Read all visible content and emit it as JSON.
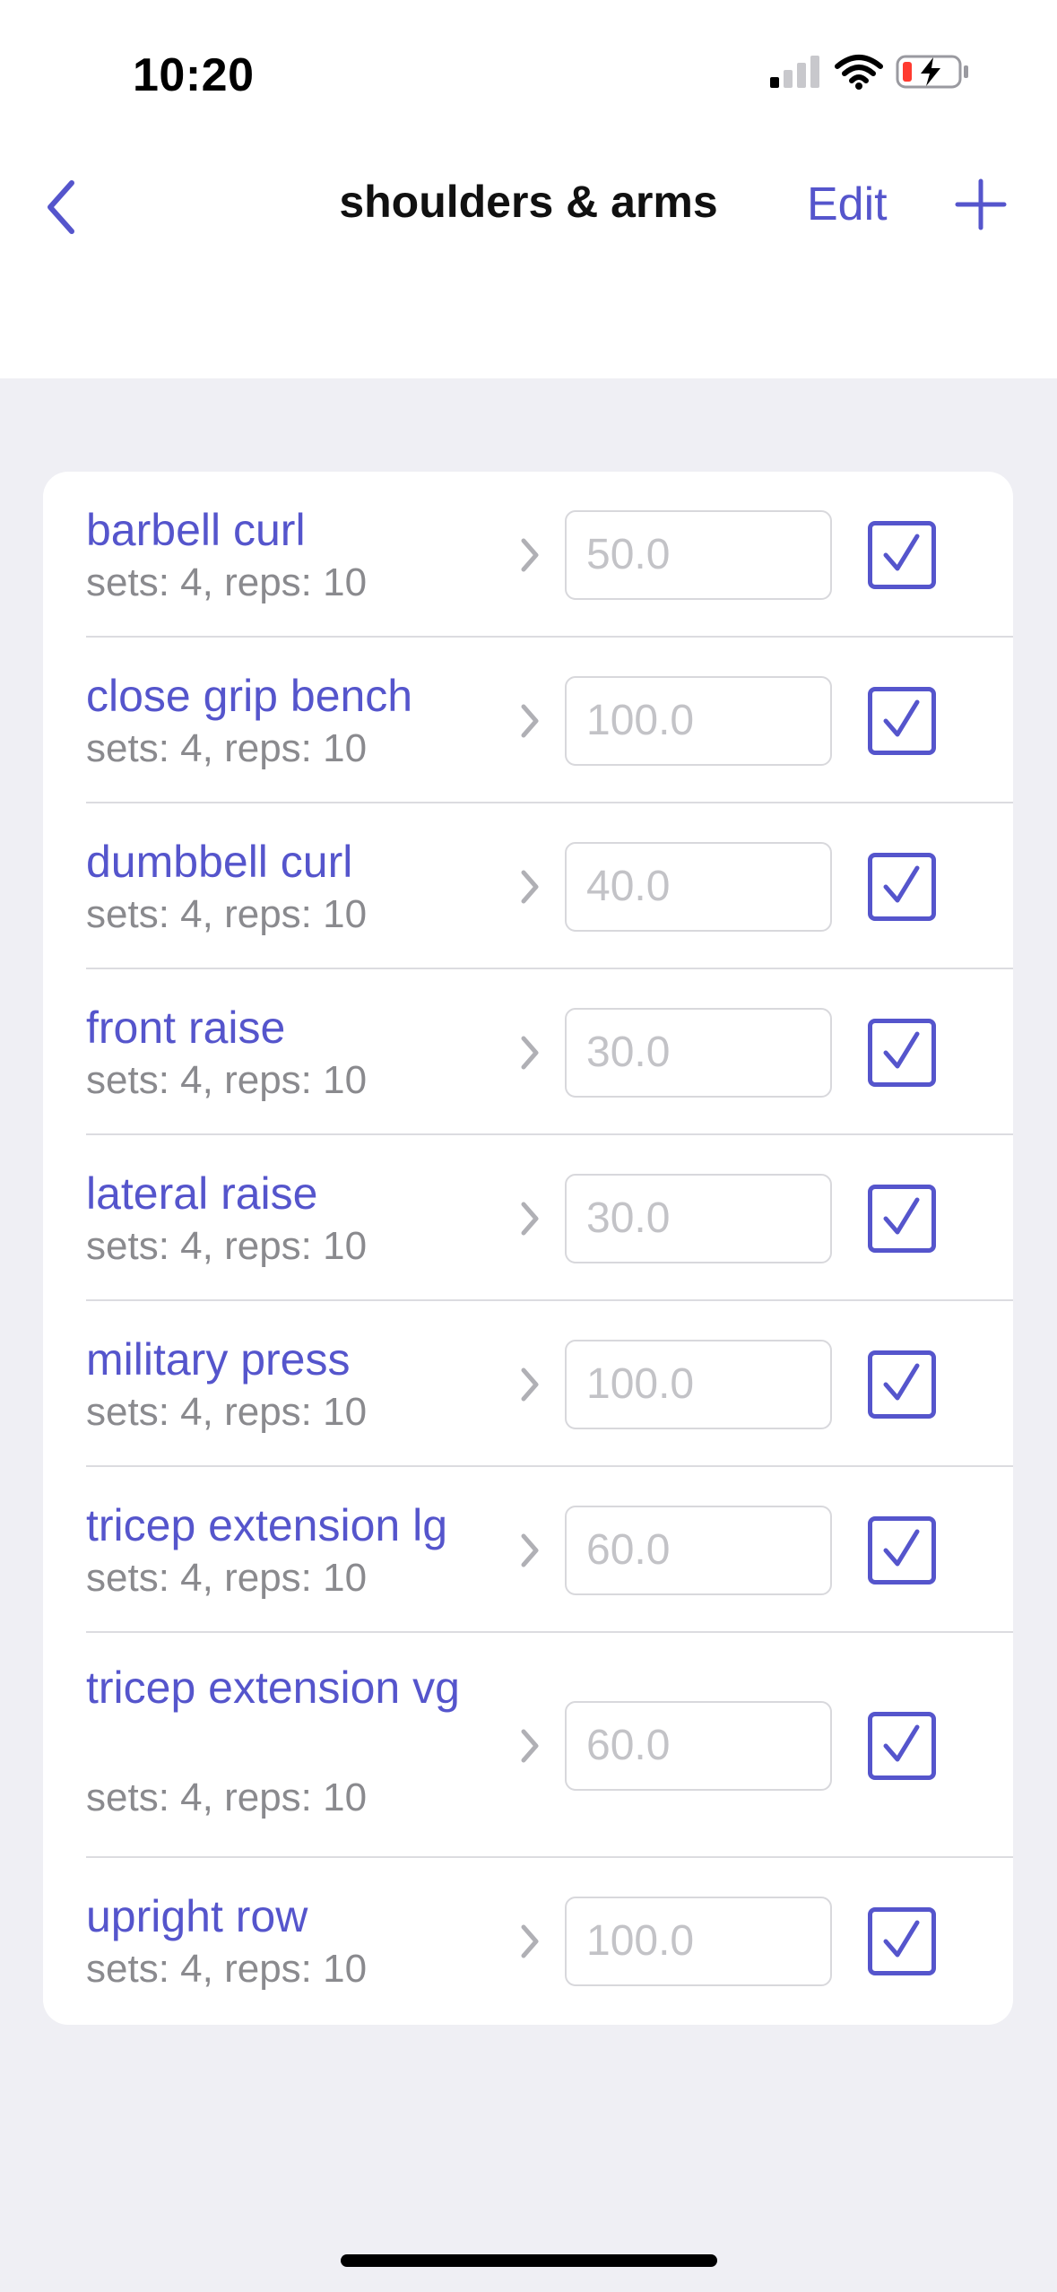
{
  "status_bar": {
    "time": "10:20",
    "icons": [
      "cellular-signal-icon",
      "wifi-icon",
      "battery-charging-icon"
    ]
  },
  "nav": {
    "back_icon": "chevron-left-icon",
    "title": "shoulders & arms",
    "edit_label": "Edit",
    "add_icon": "plus-icon"
  },
  "colors": {
    "accent": "#5555cc",
    "background": "#efeff4",
    "subtitle": "#8a8a8e",
    "placeholder": "#c3c3c7"
  },
  "exercises": [
    {
      "name": "barbell curl",
      "details": "sets: 4, reps: 10",
      "weight_placeholder": "50.0",
      "checked": true
    },
    {
      "name": "close grip bench",
      "details": "sets: 4, reps: 10",
      "weight_placeholder": "100.0",
      "checked": true
    },
    {
      "name": "dumbbell curl",
      "details": "sets: 4, reps: 10",
      "weight_placeholder": "40.0",
      "checked": true
    },
    {
      "name": "front raise",
      "details": "sets: 4, reps: 10",
      "weight_placeholder": "30.0",
      "checked": true
    },
    {
      "name": "lateral raise",
      "details": "sets: 4, reps: 10",
      "weight_placeholder": "30.0",
      "checked": true
    },
    {
      "name": "military press",
      "details": "sets: 4, reps: 10",
      "weight_placeholder": "100.0",
      "checked": true
    },
    {
      "name": "tricep extension lg",
      "details": "sets: 4, reps: 10",
      "weight_placeholder": "60.0",
      "checked": true
    },
    {
      "name": "tricep extension vg",
      "details": "sets: 4, reps: 10",
      "weight_placeholder": "60.0",
      "checked": true
    },
    {
      "name": "upright row",
      "details": "sets: 4, reps: 10",
      "weight_placeholder": "100.0",
      "checked": true
    }
  ]
}
